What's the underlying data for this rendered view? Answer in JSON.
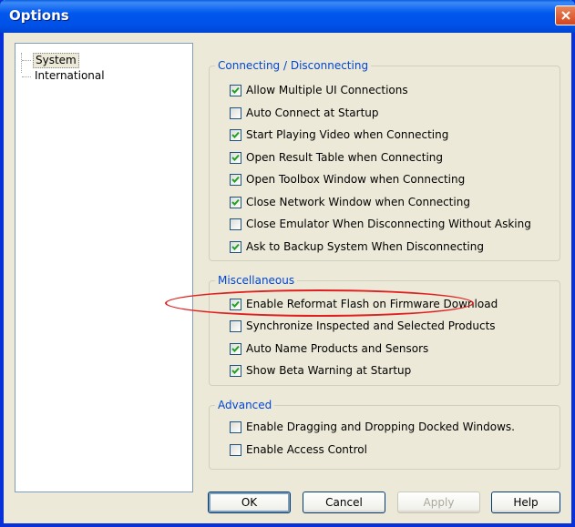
{
  "window": {
    "title": "Options"
  },
  "tree": {
    "items": [
      {
        "label": "System",
        "selected": true
      },
      {
        "label": "International",
        "selected": false
      }
    ]
  },
  "groups": [
    {
      "title": "Connecting / Disconnecting",
      "items": [
        {
          "label": "Allow Multiple UI Connections",
          "checked": true
        },
        {
          "label": "Auto Connect at Startup",
          "checked": false
        },
        {
          "label": "Start Playing Video when Connecting",
          "checked": true
        },
        {
          "label": "Open Result Table when Connecting",
          "checked": true
        },
        {
          "label": "Open Toolbox Window when Connecting",
          "checked": true
        },
        {
          "label": "Close Network Window when Connecting",
          "checked": true
        },
        {
          "label": "Close Emulator When Disconnecting Without Asking",
          "checked": false
        },
        {
          "label": "Ask to Backup System When Disconnecting",
          "checked": true
        }
      ]
    },
    {
      "title": "Miscellaneous",
      "items": [
        {
          "label": "Enable Reformat Flash on Firmware Download",
          "checked": true
        },
        {
          "label": "Synchronize Inspected and Selected Products",
          "checked": false
        },
        {
          "label": "Auto Name Products and Sensors",
          "checked": true
        },
        {
          "label": "Show Beta Warning at Startup",
          "checked": true
        }
      ]
    },
    {
      "title": "Advanced",
      "items": [
        {
          "label": "Enable Dragging and Dropping Docked Windows.",
          "checked": false
        },
        {
          "label": "Enable Access Control",
          "checked": false
        }
      ]
    }
  ],
  "buttons": {
    "ok": "OK",
    "cancel": "Cancel",
    "apply": "Apply",
    "help": "Help"
  },
  "colors": {
    "titlebar": "#0058ee",
    "group_title": "#0046d5",
    "annotation": "#e02020",
    "close_button": "#d6431c"
  }
}
